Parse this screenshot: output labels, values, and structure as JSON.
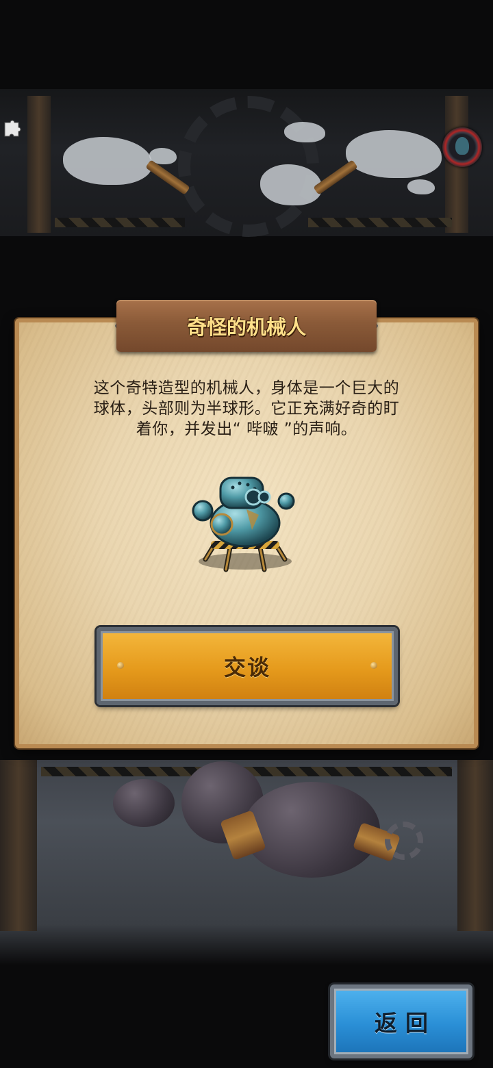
{
  "dialog": {
    "title": "奇怪的机械人",
    "description_lines": [
      "这个奇特造型的机械人，身体是一个巨大的",
      "球体，头部则为半球形。它正充满好奇的盯",
      "着你，并发出“ 哔啵 ”的声响。"
    ],
    "talk_label": "交谈"
  },
  "nav": {
    "back_label": "返回"
  },
  "icons": {
    "top_left": "puzzle-piece-icon",
    "top_right": "character-token-icon",
    "center": "sphere-robot-icon"
  },
  "colors": {
    "parchment": "#ead6b0",
    "title_text": "#ffe08a",
    "talk_button": "#e59a1c",
    "back_button": "#2a8fd6"
  }
}
